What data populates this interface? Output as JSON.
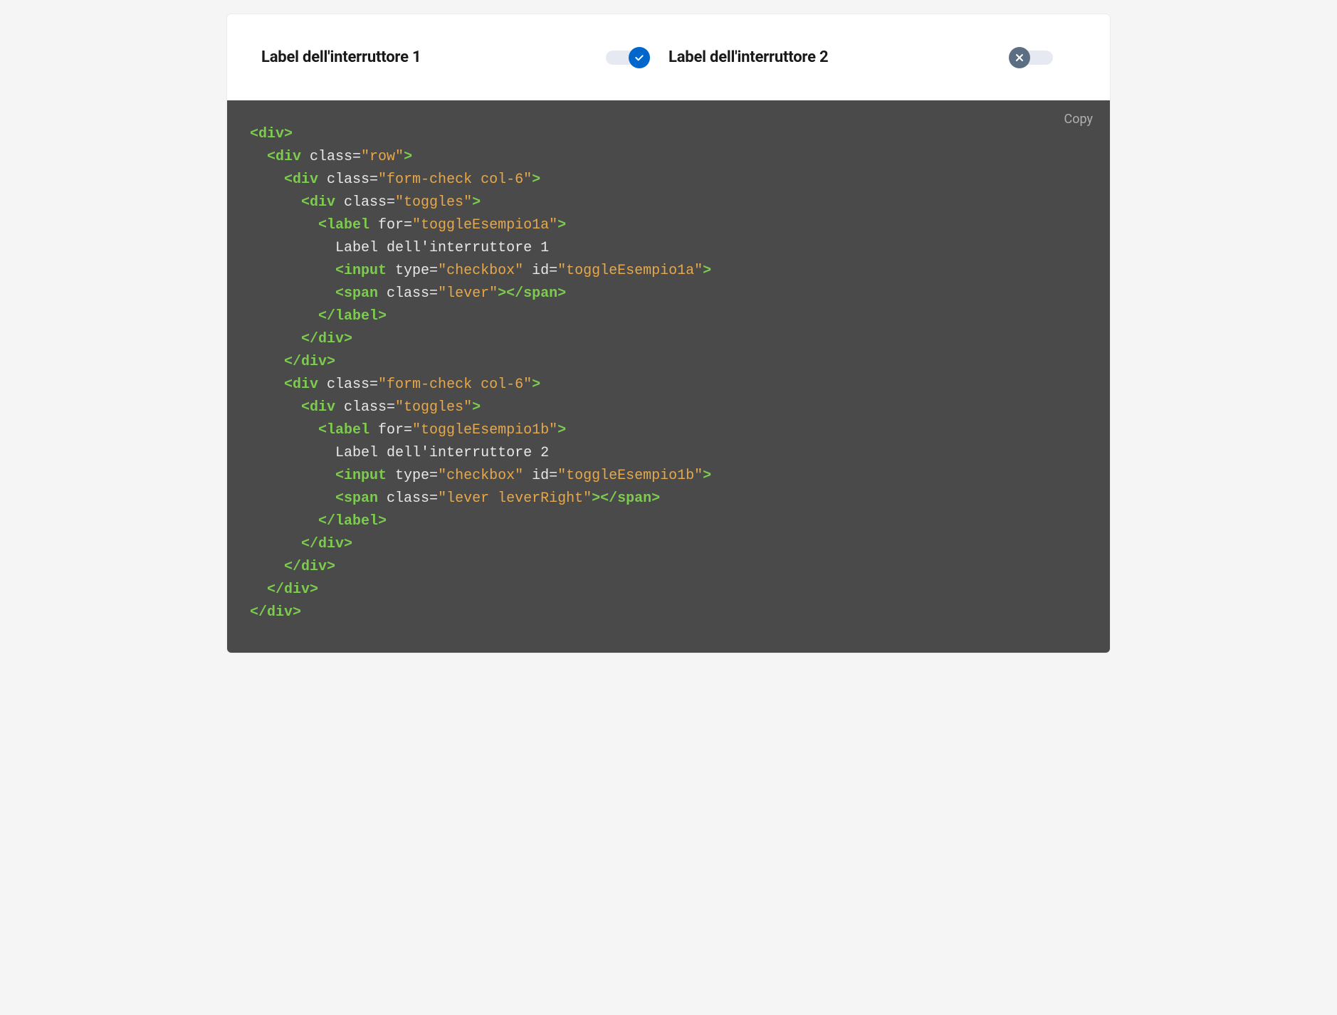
{
  "demo": {
    "toggle1": {
      "label": "Label dell'interruttore 1",
      "state": "on"
    },
    "toggle2": {
      "label": "Label dell'interruttore 2",
      "state": "off"
    }
  },
  "copy_label": "Copy",
  "code": {
    "lines": [
      {
        "indent": 0,
        "tokens": [
          {
            "t": "tag",
            "v": "<div>"
          }
        ]
      },
      {
        "indent": 1,
        "tokens": [
          {
            "t": "tag",
            "v": "<div"
          },
          {
            "t": "attr",
            "v": " class="
          },
          {
            "t": "val",
            "v": "\"row\""
          },
          {
            "t": "tag",
            "v": ">"
          }
        ]
      },
      {
        "indent": 2,
        "tokens": [
          {
            "t": "tag",
            "v": "<div"
          },
          {
            "t": "attr",
            "v": " class="
          },
          {
            "t": "val",
            "v": "\"form-check col-6\""
          },
          {
            "t": "tag",
            "v": ">"
          }
        ]
      },
      {
        "indent": 3,
        "tokens": [
          {
            "t": "tag",
            "v": "<div"
          },
          {
            "t": "attr",
            "v": " class="
          },
          {
            "t": "val",
            "v": "\"toggles\""
          },
          {
            "t": "tag",
            "v": ">"
          }
        ]
      },
      {
        "indent": 4,
        "tokens": [
          {
            "t": "tag",
            "v": "<label"
          },
          {
            "t": "attr",
            "v": " for="
          },
          {
            "t": "val",
            "v": "\"toggleEsempio1a\""
          },
          {
            "t": "tag",
            "v": ">"
          }
        ]
      },
      {
        "indent": 5,
        "tokens": [
          {
            "t": "attr",
            "v": "Label dell'interruttore 1"
          }
        ]
      },
      {
        "indent": 5,
        "tokens": [
          {
            "t": "tag",
            "v": "<input"
          },
          {
            "t": "attr",
            "v": " type="
          },
          {
            "t": "val",
            "v": "\"checkbox\""
          },
          {
            "t": "attr",
            "v": " id="
          },
          {
            "t": "val",
            "v": "\"toggleEsempio1a\""
          },
          {
            "t": "tag",
            "v": ">"
          }
        ]
      },
      {
        "indent": 5,
        "tokens": [
          {
            "t": "tag",
            "v": "<span"
          },
          {
            "t": "attr",
            "v": " class="
          },
          {
            "t": "val",
            "v": "\"lever\""
          },
          {
            "t": "tag",
            "v": "></span>"
          }
        ]
      },
      {
        "indent": 4,
        "tokens": [
          {
            "t": "tag",
            "v": "</label>"
          }
        ]
      },
      {
        "indent": 3,
        "tokens": [
          {
            "t": "tag",
            "v": "</div>"
          }
        ]
      },
      {
        "indent": 2,
        "tokens": [
          {
            "t": "tag",
            "v": "</div>"
          }
        ]
      },
      {
        "indent": 2,
        "tokens": [
          {
            "t": "tag",
            "v": "<div"
          },
          {
            "t": "attr",
            "v": " class="
          },
          {
            "t": "val",
            "v": "\"form-check col-6\""
          },
          {
            "t": "tag",
            "v": ">"
          }
        ]
      },
      {
        "indent": 3,
        "tokens": [
          {
            "t": "tag",
            "v": "<div"
          },
          {
            "t": "attr",
            "v": " class="
          },
          {
            "t": "val",
            "v": "\"toggles\""
          },
          {
            "t": "tag",
            "v": ">"
          }
        ]
      },
      {
        "indent": 4,
        "tokens": [
          {
            "t": "tag",
            "v": "<label"
          },
          {
            "t": "attr",
            "v": " for="
          },
          {
            "t": "val",
            "v": "\"toggleEsempio1b\""
          },
          {
            "t": "tag",
            "v": ">"
          }
        ]
      },
      {
        "indent": 5,
        "tokens": [
          {
            "t": "attr",
            "v": "Label dell'interruttore 2"
          }
        ]
      },
      {
        "indent": 5,
        "tokens": [
          {
            "t": "tag",
            "v": "<input"
          },
          {
            "t": "attr",
            "v": " type="
          },
          {
            "t": "val",
            "v": "\"checkbox\""
          },
          {
            "t": "attr",
            "v": " id="
          },
          {
            "t": "val",
            "v": "\"toggleEsempio1b\""
          },
          {
            "t": "tag",
            "v": ">"
          }
        ]
      },
      {
        "indent": 5,
        "tokens": [
          {
            "t": "tag",
            "v": "<span"
          },
          {
            "t": "attr",
            "v": " class="
          },
          {
            "t": "val",
            "v": "\"lever leverRight\""
          },
          {
            "t": "tag",
            "v": "></span>"
          }
        ]
      },
      {
        "indent": 4,
        "tokens": [
          {
            "t": "tag",
            "v": "</label>"
          }
        ]
      },
      {
        "indent": 3,
        "tokens": [
          {
            "t": "tag",
            "v": "</div>"
          }
        ]
      },
      {
        "indent": 2,
        "tokens": [
          {
            "t": "tag",
            "v": "</div>"
          }
        ]
      },
      {
        "indent": 1,
        "tokens": [
          {
            "t": "tag",
            "v": "</div>"
          }
        ]
      },
      {
        "indent": 0,
        "tokens": [
          {
            "t": "tag",
            "v": "</div>"
          }
        ]
      }
    ]
  }
}
